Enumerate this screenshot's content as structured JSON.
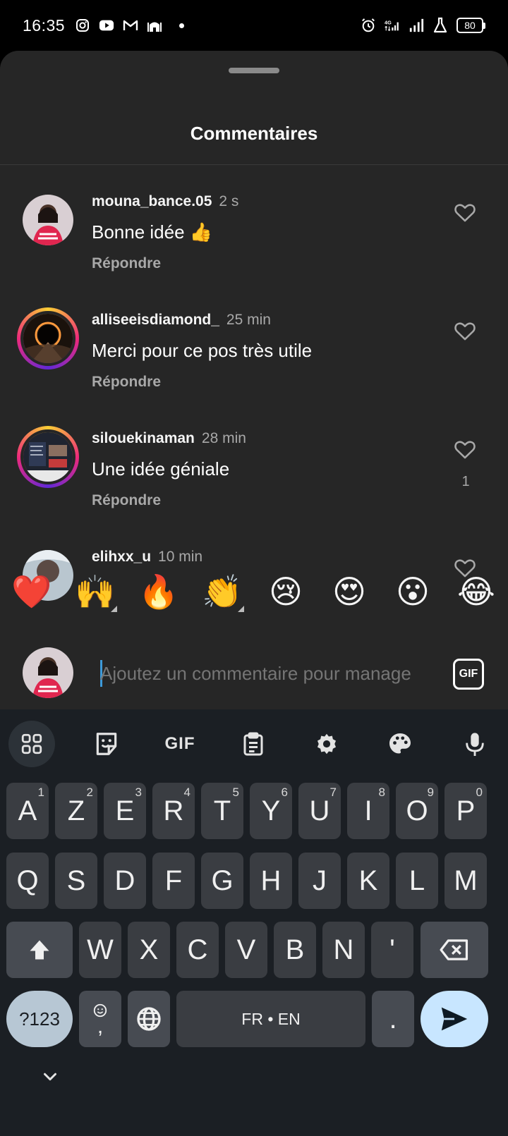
{
  "status_bar": {
    "time": "16:35",
    "left_icons": [
      "instagram-icon",
      "youtube-icon",
      "gmail-icon",
      "mosque-icon"
    ],
    "right_icons": [
      "alarm-icon",
      "4g-data-icon",
      "signal-icon",
      "signal-icon",
      "flask-icon"
    ],
    "network": "4G",
    "battery": "80"
  },
  "sheet": {
    "title": "Commentaires"
  },
  "comments": [
    {
      "username": "mouna_bance.05",
      "time": "2 s",
      "text": "Bonne idée 👍",
      "reply": "Répondre",
      "likes": ""
    },
    {
      "username": "alliseeisdiamond_",
      "time": "25 min",
      "text": "Merci pour ce pos très utile",
      "reply": "Répondre",
      "likes": ""
    },
    {
      "username": "silouekinaman",
      "time": "28 min",
      "text": "Une idée géniale",
      "reply": "Répondre",
      "likes": "1"
    },
    {
      "username": "elihxx_u",
      "time": "10 min",
      "text": "",
      "reply": "",
      "likes": ""
    }
  ],
  "reactions": [
    "❤️",
    "🙌",
    "🔥",
    "👏",
    "😢",
    "😍",
    "😮",
    "😂"
  ],
  "composer": {
    "placeholder": "Ajoutez un commentaire pour manage",
    "gif_label": "GIF"
  },
  "keyboard": {
    "toolbar": [
      "apps-grid-icon",
      "sticker-icon",
      "GIF",
      "clipboard-icon",
      "settings-icon",
      "palette-icon",
      "microphone-icon"
    ],
    "toolbar_gif": "GIF",
    "row1": [
      {
        "k": "A",
        "s": "1"
      },
      {
        "k": "Z",
        "s": "2"
      },
      {
        "k": "E",
        "s": "3"
      },
      {
        "k": "R",
        "s": "4"
      },
      {
        "k": "T",
        "s": "5"
      },
      {
        "k": "Y",
        "s": "6"
      },
      {
        "k": "U",
        "s": "7"
      },
      {
        "k": "I",
        "s": "8"
      },
      {
        "k": "O",
        "s": "9"
      },
      {
        "k": "P",
        "s": "0"
      }
    ],
    "row2": [
      "Q",
      "S",
      "D",
      "F",
      "G",
      "H",
      "J",
      "K",
      "L",
      "M"
    ],
    "row3": [
      "W",
      "X",
      "C",
      "V",
      "B",
      "N",
      "'"
    ],
    "numbers_key": "?123",
    "comma_key": ",",
    "space_label": "FR • EN",
    "period_key": "."
  },
  "colors": {
    "sheet_bg": "#262626",
    "keyboard_bg": "#1b1f24",
    "key_bg": "#3a3d42",
    "send_bg": "#c8e6ff",
    "accent_caret": "#3d9ad9"
  }
}
